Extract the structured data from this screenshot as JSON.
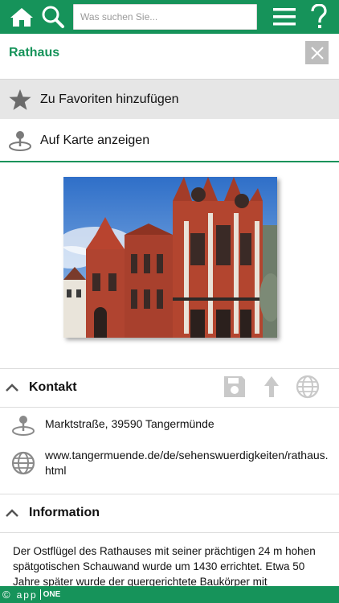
{
  "topbar": {
    "search_placeholder": "Was suchen Sie...",
    "icons": [
      "home-icon",
      "search-icon",
      "menu-icon",
      "help-icon"
    ]
  },
  "header": {
    "title": "Rathaus"
  },
  "actions": {
    "favorite_label": "Zu Favoriten hinzufügen",
    "map_label": "Auf Karte anzeigen"
  },
  "kontakt": {
    "title": "Kontakt",
    "address": "Marktstraße, 39590 Tangermünde",
    "url": "www.tangermuende.de/de/sehenswuerdigkeiten/rathaus.html"
  },
  "information": {
    "title": "Information",
    "text": "Der Ostflügel des Rathauses mit seiner prächtigen 24 m hohen spätgotischen Schauwand wurde um 1430 errichtet. Etwa 50 Jahre später wurde der quergerichtete Baukörper mit"
  },
  "footer": {
    "copyright": "©",
    "brand_app": "app",
    "brand_one": "ONE"
  },
  "colors": {
    "brand_green": "#16935a",
    "row_grey": "#e6e6e6",
    "icon_grey": "#7a7a7a"
  }
}
